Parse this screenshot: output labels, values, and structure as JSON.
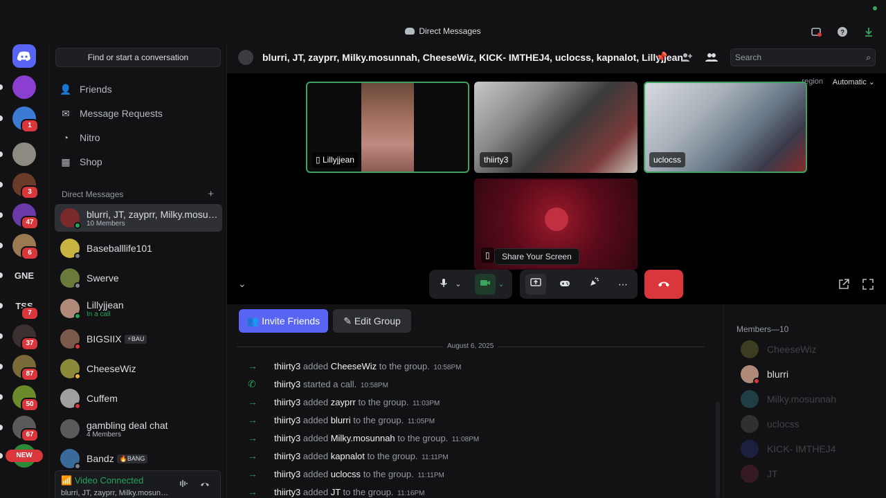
{
  "window": {
    "title": "Direct Messages"
  },
  "rail": {
    "servers": [
      {
        "label": "",
        "badge": "",
        "color": "#5865f2",
        "icon": "discord-logo-icon"
      },
      {
        "label": "",
        "badge": "",
        "color": "#8a3fd1"
      },
      {
        "label": "",
        "badge": "1",
        "color": "#3b7bd4"
      },
      {
        "label": "",
        "badge": "",
        "color": "#8d8a82"
      },
      {
        "label": "",
        "badge": "3",
        "color": "#6b3b2a"
      },
      {
        "label": "",
        "badge": "47",
        "color": "#6a3aa8"
      },
      {
        "label": "",
        "badge": "6",
        "color": "#9b7a52"
      },
      {
        "label": "GNE",
        "badge": "",
        "color": "#121214"
      },
      {
        "label": "TSS",
        "badge": "7",
        "color": "#121214"
      },
      {
        "label": "",
        "badge": "37",
        "color": "#3b3030"
      },
      {
        "label": "",
        "badge": "87",
        "color": "#7a6a3a"
      },
      {
        "label": "",
        "badge": "50",
        "color": "#6b8a2a"
      },
      {
        "label": "",
        "badge": "67",
        "color": "#5a5a5a"
      },
      {
        "label": "",
        "badge": "",
        "color": "#2a8a3a"
      }
    ],
    "new_label": "NEW"
  },
  "sidebar": {
    "search_label": "Find or start a conversation",
    "nav": [
      {
        "label": "Friends",
        "icon": "friends-icon"
      },
      {
        "label": "Message Requests",
        "icon": "mail-icon"
      },
      {
        "label": "Nitro",
        "icon": "nitro-icon"
      },
      {
        "label": "Shop",
        "icon": "shop-icon"
      }
    ],
    "dm_header": "Direct Messages",
    "dms": [
      {
        "name": "blurri, JT, zayprr, Milky.mosunnah, CheeseWiz, KICK- IMTHEJ4, uclocss, kapnalot, Lillyjjean",
        "sub": "10 Members",
        "tag": "",
        "color": "#7a2a2a",
        "status": "#23a55a"
      },
      {
        "name": "Baseballlife101",
        "sub": "",
        "tag": "",
        "color": "#c9b341",
        "status": "#80848e"
      },
      {
        "name": "Swerve",
        "sub": "",
        "tag": "",
        "color": "#6a7a3a",
        "status": "#80848e"
      },
      {
        "name": "Lillyjjean",
        "sub": "In a call",
        "tag": "",
        "color": "#b08a78",
        "status": "#23a55a"
      },
      {
        "name": "BIGSIIX",
        "sub": "",
        "tag": "⚡BAU",
        "color": "#7a5a4a",
        "status": "#da373c"
      },
      {
        "name": "CheeseWiz",
        "sub": "",
        "tag": "",
        "color": "#8a8a3a",
        "status": "#f0b232"
      },
      {
        "name": "Cuffem",
        "sub": "",
        "tag": "",
        "color": "#a0a0a0",
        "status": "#da373c"
      },
      {
        "name": "gambling deal chat",
        "sub": "4 Members",
        "tag": "",
        "color": "#5a5a5a",
        "status": ""
      },
      {
        "name": "Bandz",
        "sub": "",
        "tag": "🔥BANG",
        "color": "#3a6a9a",
        "status": "#80848e"
      }
    ],
    "voice": {
      "status": "Video Connected",
      "channel": "blurri, JT, zayprr, Milky.mosunnah, CheeseWiz, KICK- IMTHEJ4, uclocss, kapnalot, Lillyjjean"
    }
  },
  "header": {
    "group_name": "blurri, JT, zayprr, Milky.mosunnah, CheeseWiz, KICK- IMTHEJ4, uclocss, kapnalot, Lillyjjean",
    "search_placeholder": "Search"
  },
  "call": {
    "region_label": "region",
    "region_value": "Automatic",
    "tiles": [
      {
        "name": "Lillyjjean",
        "speaking": true,
        "mobile": true
      },
      {
        "name": "thiirty3",
        "speaking": false,
        "mobile": false
      },
      {
        "name": "uclocss",
        "speaking": true,
        "mobile": false
      },
      {
        "name": "",
        "speaking": false,
        "mobile": true
      }
    ],
    "tooltip": "Share Your Screen"
  },
  "chat": {
    "invite_label": "Invite Friends",
    "edit_label": "Edit Group",
    "date": "August 6, 2025",
    "messages": [
      {
        "actor": "thiirty3",
        "verb": "added",
        "target": "CheeseWiz",
        "tail": "to the group.",
        "time": "10:58PM",
        "type": "add"
      },
      {
        "actor": "thiirty3",
        "verb": "started a call.",
        "target": "",
        "tail": "",
        "time": "10:58PM",
        "type": "call"
      },
      {
        "actor": "thiirty3",
        "verb": "added",
        "target": "zayprr",
        "tail": "to the group.",
        "time": "11:03PM",
        "type": "add"
      },
      {
        "actor": "thiirty3",
        "verb": "added",
        "target": "blurri",
        "tail": "to the group.",
        "time": "11:05PM",
        "type": "add"
      },
      {
        "actor": "thiirty3",
        "verb": "added",
        "target": "Milky.mosunnah",
        "tail": "to the group.",
        "time": "11:08PM",
        "type": "add"
      },
      {
        "actor": "thiirty3",
        "verb": "added",
        "target": "kapnalot",
        "tail": "to the group.",
        "time": "11:11PM",
        "type": "add"
      },
      {
        "actor": "thiirty3",
        "verb": "added",
        "target": "uclocss",
        "tail": "to the group.",
        "time": "11:11PM",
        "type": "add"
      },
      {
        "actor": "thiirty3",
        "verb": "added",
        "target": "JT",
        "tail": "to the group.",
        "time": "11:16PM",
        "type": "add"
      }
    ]
  },
  "members": {
    "header": "Members—10",
    "list": [
      {
        "name": "CheeseWiz",
        "dim": true,
        "color": "#8a8a3a"
      },
      {
        "name": "blurri",
        "dim": false,
        "color": "#b08a78"
      },
      {
        "name": "Milky.mosunnah",
        "dim": true,
        "color": "#3a8aa0"
      },
      {
        "name": "uclocss",
        "dim": true,
        "color": "#6a6a6a"
      },
      {
        "name": "KICK- IMTHEJ4",
        "dim": true,
        "color": "#2a3a8a"
      },
      {
        "name": "JT",
        "dim": true,
        "color": "#7a2a3a"
      }
    ]
  }
}
